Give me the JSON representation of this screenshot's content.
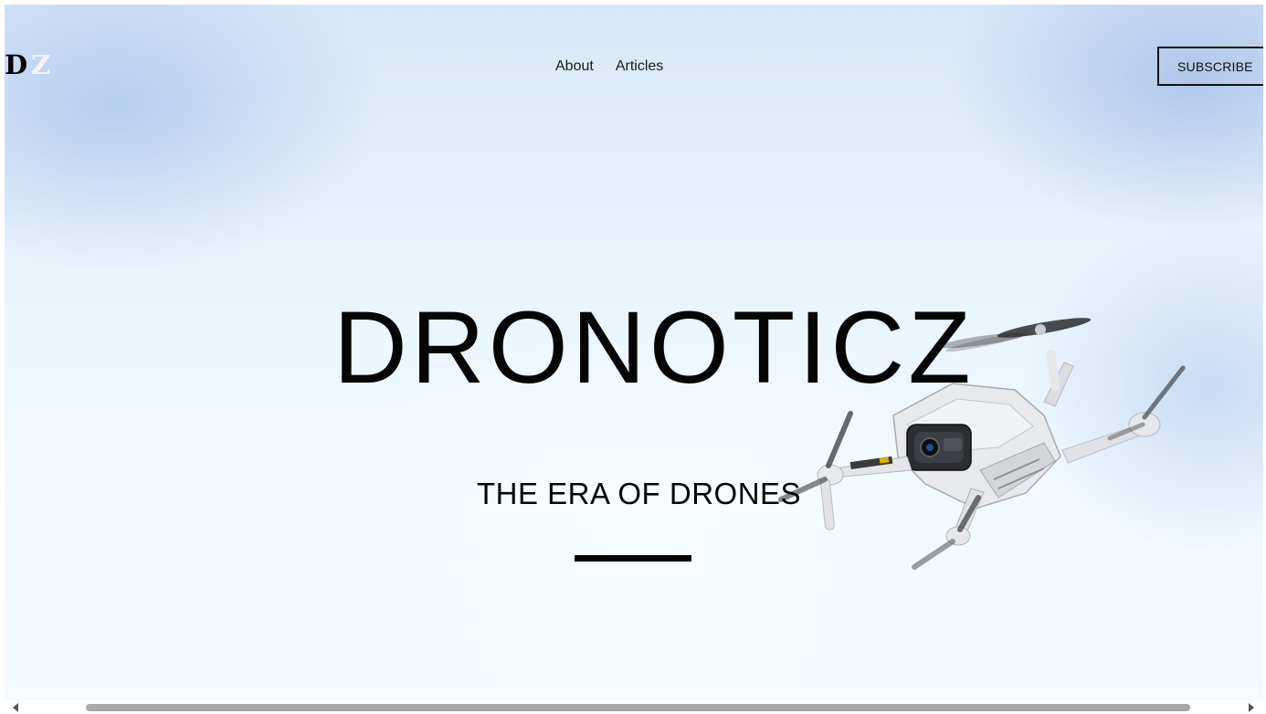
{
  "header": {
    "logo": {
      "letter1": "D",
      "letter2": "Z"
    },
    "nav": [
      {
        "label": "About"
      },
      {
        "label": "Articles"
      }
    ],
    "subscribe_label": "SUBSCRIBE"
  },
  "hero": {
    "title": "DRONOTICZ",
    "subtitle": "THE ERA OF DRONES",
    "image_icon": "drone-icon"
  },
  "colors": {
    "text": "#050505",
    "sky_top": "#d7e7f8",
    "sky_bottom": "#f5fbff",
    "drone_body": "#e9eaec"
  }
}
